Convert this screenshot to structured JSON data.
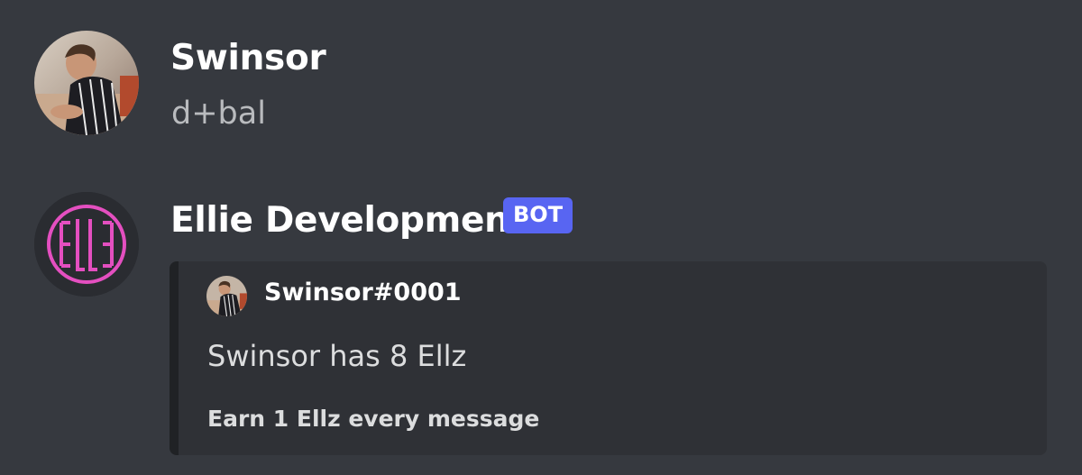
{
  "messages": [
    {
      "author": "Swinsor",
      "content": "d+bal",
      "avatar": "user-photo-avatar"
    },
    {
      "author": "Ellie Development",
      "badge": "BOT",
      "avatar": "ellz-logo-avatar",
      "embed": {
        "author": "Swinsor#0001",
        "description": "Swinsor has 8 Ellz",
        "footer": "Earn 1 Ellz every message"
      }
    }
  ],
  "colors": {
    "background": "#36393f",
    "embed_background": "#2f3136",
    "embed_accent": "#202225",
    "bot_badge": "#5865f2",
    "logo_pink": "#e44fc0"
  }
}
